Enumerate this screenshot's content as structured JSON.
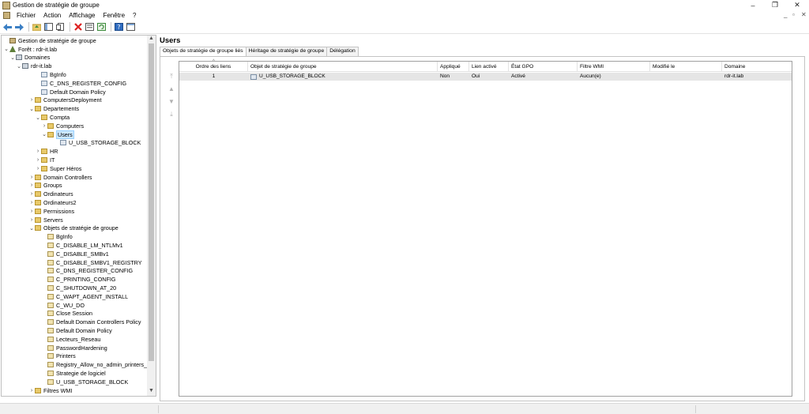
{
  "window": {
    "title": "Gestion de stratégie de groupe",
    "controls": {
      "minimize": "–",
      "restore": "❐",
      "close": "✕"
    },
    "mdi_controls": {
      "minimize": "_",
      "restore": "▫",
      "close": "✕"
    }
  },
  "menu": [
    "Fichier",
    "Action",
    "Affichage",
    "Fenêtre",
    "?"
  ],
  "toolbar": {
    "buttons": [
      "back-icon",
      "forward-icon",
      "up-folder-icon",
      "show-hide-tree-icon",
      "copy-icon",
      "delete-icon",
      "properties-icon",
      "refresh-icon",
      "help-icon",
      "console-view-icon"
    ]
  },
  "tree": {
    "items": [
      {
        "label": "Gestion de stratégie de groupe",
        "type": "root",
        "twisty": ""
      },
      {
        "label": "Forêt : rdr-it.lab",
        "type": "forest",
        "twisty": "⌄"
      },
      {
        "label": "Domaines",
        "type": "domain",
        "twisty": "⌄"
      },
      {
        "label": "rdr-it.lab",
        "type": "domain",
        "twisty": "⌄"
      },
      {
        "label": "BgInfo",
        "type": "gpo-link",
        "twisty": ""
      },
      {
        "label": "C_DNS_REGISTER_CONFIG",
        "type": "gpo-link",
        "twisty": ""
      },
      {
        "label": "Default Domain Policy",
        "type": "gpo-link",
        "twisty": ""
      },
      {
        "label": "ComputersDeployment",
        "type": "ou",
        "twisty": "›"
      },
      {
        "label": "Departements",
        "type": "ou",
        "twisty": "⌄"
      },
      {
        "label": "Compta",
        "type": "ou",
        "twisty": "⌄"
      },
      {
        "label": "Computers",
        "type": "ou",
        "twisty": "›"
      },
      {
        "label": "Users",
        "type": "ou",
        "twisty": "⌄"
      },
      {
        "label": "U_USB_STORAGE_BLOCK",
        "type": "gpo-link",
        "twisty": ""
      },
      {
        "label": "HR",
        "type": "ou",
        "twisty": "›"
      },
      {
        "label": "IT",
        "type": "ou",
        "twisty": "›"
      },
      {
        "label": "Super Héros",
        "type": "ou",
        "twisty": "›"
      },
      {
        "label": "Domain Controllers",
        "type": "ou",
        "twisty": "›"
      },
      {
        "label": "Groups",
        "type": "ou",
        "twisty": "›"
      },
      {
        "label": "Ordinateurs",
        "type": "ou",
        "twisty": "›"
      },
      {
        "label": "Ordinateurs2",
        "type": "ou",
        "twisty": "›"
      },
      {
        "label": "Permissions",
        "type": "ou",
        "twisty": "›"
      },
      {
        "label": "Servers",
        "type": "ou",
        "twisty": "›"
      },
      {
        "label": "Objets de stratégie de groupe",
        "type": "folder",
        "twisty": "⌄"
      },
      {
        "label": "BgInfo",
        "type": "gpo",
        "twisty": ""
      },
      {
        "label": "C_DISABLE_LM_NTLMv1",
        "type": "gpo",
        "twisty": ""
      },
      {
        "label": "C_DISABLE_SMBv1",
        "type": "gpo",
        "twisty": ""
      },
      {
        "label": "C_DISABLE_SMBV1_REGISTRY",
        "type": "gpo",
        "twisty": ""
      },
      {
        "label": "C_DNS_REGISTER_CONFIG",
        "type": "gpo",
        "twisty": ""
      },
      {
        "label": "C_PRINTING_CONFIG",
        "type": "gpo",
        "twisty": ""
      },
      {
        "label": "C_SHUTDOWN_AT_20",
        "type": "gpo",
        "twisty": ""
      },
      {
        "label": "C_WAPT_AGENT_INSTALL",
        "type": "gpo",
        "twisty": ""
      },
      {
        "label": "C_WU_DO",
        "type": "gpo",
        "twisty": ""
      },
      {
        "label": "Close Session",
        "type": "gpo",
        "twisty": ""
      },
      {
        "label": "Default Domain Controllers Policy",
        "type": "gpo",
        "twisty": ""
      },
      {
        "label": "Default Domain Policy",
        "type": "gpo",
        "twisty": ""
      },
      {
        "label": "Lecteurs_Reseau",
        "type": "gpo",
        "twisty": ""
      },
      {
        "label": "PasswordHardening",
        "type": "gpo",
        "twisty": ""
      },
      {
        "label": "Printers",
        "type": "gpo",
        "twisty": ""
      },
      {
        "label": "Registry_Allow_no_admin_printers_c",
        "type": "gpo",
        "twisty": ""
      },
      {
        "label": "Strategie de logiciel",
        "type": "gpo",
        "twisty": ""
      },
      {
        "label": "U_USB_STORAGE_BLOCK",
        "type": "gpo",
        "twisty": ""
      },
      {
        "label": "Filtres WMI",
        "type": "folder",
        "twisty": "›"
      }
    ],
    "selected_label": "Users"
  },
  "details": {
    "header": "Users",
    "tabs": [
      "Objets de stratégie de groupe liés",
      "Héritage de stratégie de groupe",
      "Délégation"
    ],
    "active_tab": "Objets de stratégie de groupe liés",
    "columns": [
      "Ordre des liens",
      "Objet de stratégie de groupe",
      "Appliqué",
      "Lien activé",
      "État GPO",
      "Filtre WMI",
      "Modifié le",
      "Domaine"
    ],
    "rows": [
      [
        "1",
        "U_USB_STORAGE_BLOCK",
        "Non",
        "Oui",
        "Activé",
        "Aucun(e)",
        "",
        "rdr-it.lab"
      ]
    ]
  }
}
